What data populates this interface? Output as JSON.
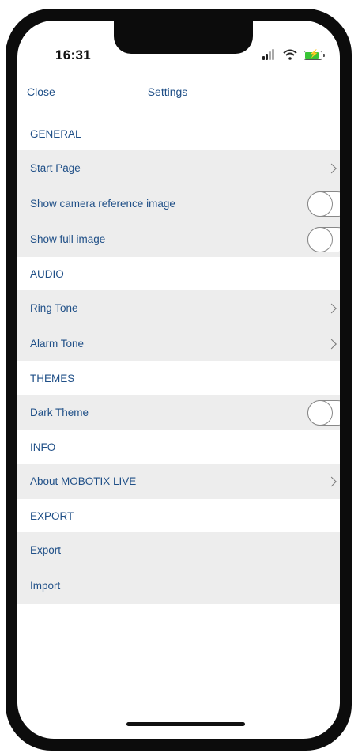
{
  "status_bar": {
    "time": "16:31",
    "icons": [
      "signal-icon",
      "wifi-icon",
      "battery-charging-icon"
    ]
  },
  "nav": {
    "close_label": "Close",
    "title": "Settings"
  },
  "sections": [
    {
      "header": "GENERAL",
      "rows": [
        {
          "label": "Start Page",
          "control": "chevron"
        },
        {
          "label": "Show camera reference image",
          "control": "toggle",
          "on": false
        },
        {
          "label": "Show full image",
          "control": "toggle",
          "on": false
        }
      ]
    },
    {
      "header": "AUDIO",
      "rows": [
        {
          "label": "Ring Tone",
          "control": "chevron"
        },
        {
          "label": "Alarm Tone",
          "control": "chevron"
        }
      ]
    },
    {
      "header": "THEMES",
      "rows": [
        {
          "label": "Dark Theme",
          "control": "toggle",
          "on": false
        }
      ]
    },
    {
      "header": "INFO",
      "rows": [
        {
          "label": "About MOBOTIX LIVE",
          "control": "chevron"
        }
      ]
    },
    {
      "header": "EXPORT",
      "rows": [
        {
          "label": "Export",
          "control": "none"
        },
        {
          "label": "Import",
          "control": "none"
        }
      ]
    }
  ],
  "colors": {
    "accent_text": "#1f4f87",
    "row_background": "#ededed",
    "battery": "#39c536"
  }
}
